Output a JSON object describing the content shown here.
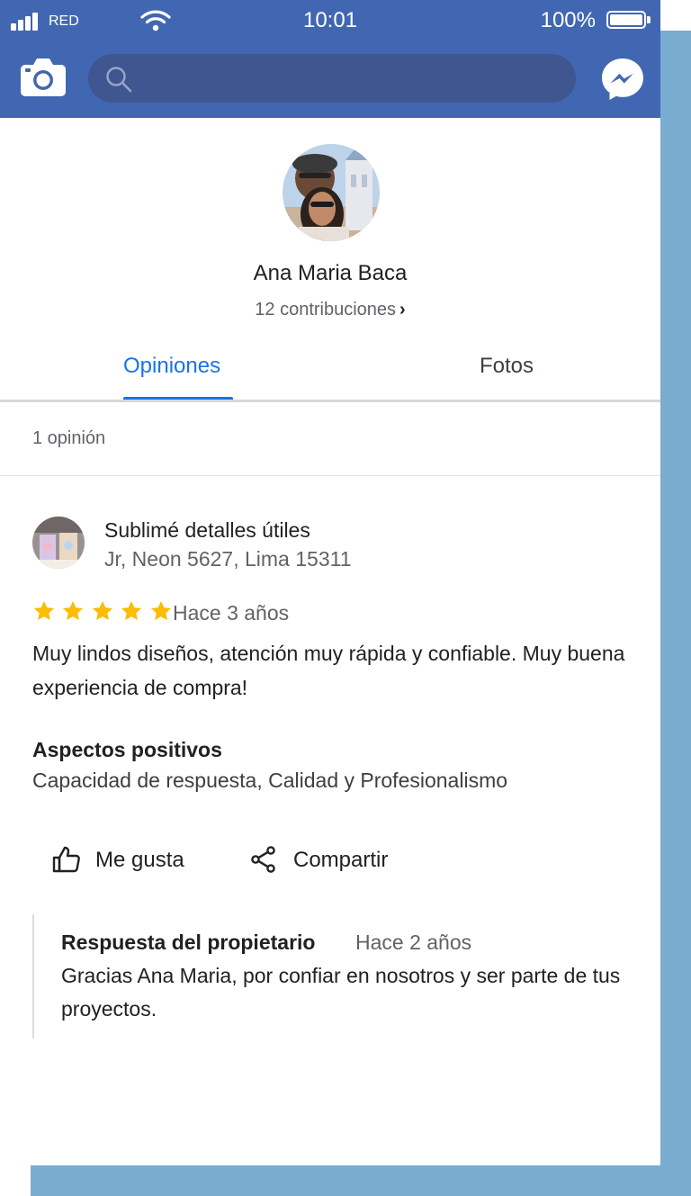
{
  "status_bar": {
    "carrier": "RED",
    "time": "10:01",
    "battery": "100%"
  },
  "search": {
    "placeholder": ""
  },
  "profile": {
    "name": "Ana Maria Baca",
    "contributions": "12 contribuciones",
    "contributions_chevron": "›"
  },
  "tabs": [
    {
      "label": "Opiniones",
      "active": true
    },
    {
      "label": "Fotos",
      "active": false
    }
  ],
  "review_count": "1 opinión",
  "review": {
    "place_name": "Sublimé detalles útiles",
    "place_address": "Jr, Neon 5627, Lima 15311",
    "rating": 5,
    "max_rating": 5,
    "time": "Hace 3 años",
    "text": "Muy lindos diseños, atención muy rápida y confiable. Muy buena experiencia de compra!",
    "positives_heading": "Aspectos positivos",
    "positives": "Capacidad de respuesta, Calidad y Profesionalismo",
    "like_label": "Me gusta",
    "share_label": "Compartir",
    "owner_reply": {
      "title": "Respuesta del propietario",
      "time": "Hace 2 años",
      "text": "Gracias Ana Maria, por confiar en nosotros y ser parte de tus proyectos."
    }
  },
  "icons": {
    "camera": "camera-icon",
    "search": "search-icon",
    "messenger": "messenger-icon",
    "like": "thumbs-up-icon",
    "share": "share-icon",
    "star": "star-icon"
  },
  "colors": {
    "app_bar": "#4267b2",
    "search_bar": "#3f5690",
    "accent": "#1a73e8",
    "star": "#fbbc04",
    "frame_shadow": "#7aaccf"
  }
}
